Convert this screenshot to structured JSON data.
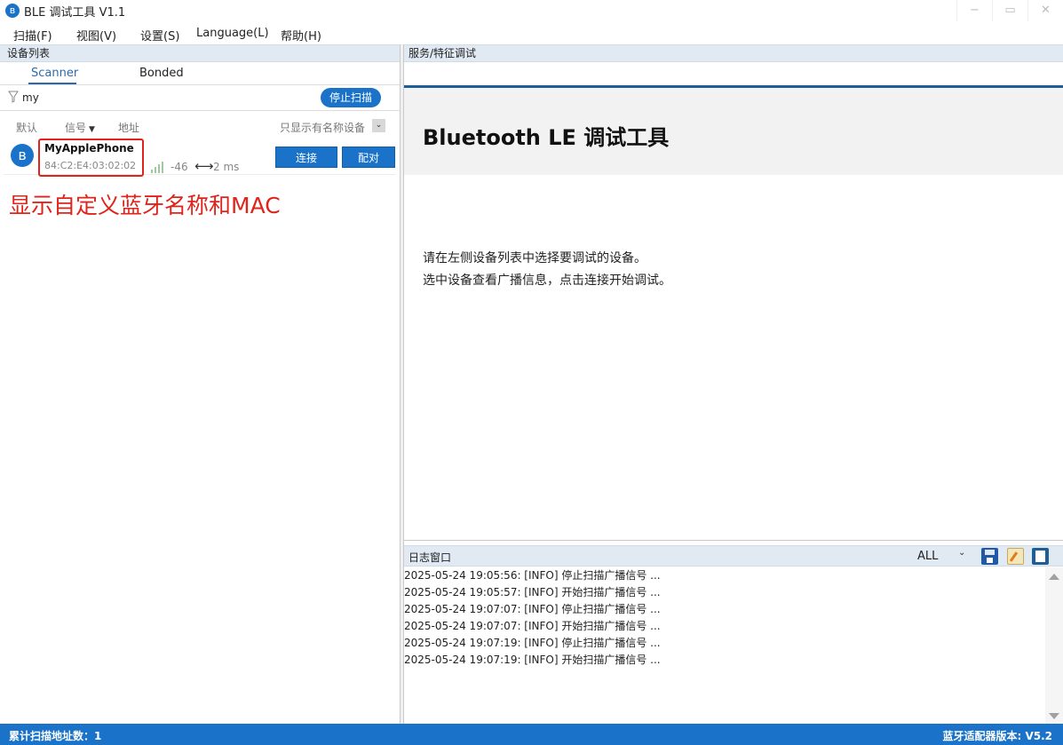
{
  "window": {
    "title": "BLE 调试工具 V1.1",
    "min_symbol": "−",
    "max_symbol": "▭",
    "close_symbol": "✕"
  },
  "menu": {
    "items": [
      "扫描(F)",
      "视图(V)",
      "设置(S)",
      "Language(L)",
      "帮助(H)"
    ]
  },
  "device_list": {
    "header": "设备列表",
    "tabs": [
      "Scanner",
      "Bonded"
    ],
    "active_tab": "Scanner",
    "filter_value": "my",
    "stop_scan_label": "停止扫描",
    "sort_options": [
      "默认",
      "信号",
      "地址"
    ],
    "named_only_label": "只显示有名称设备",
    "devices": [
      {
        "name": "MyApplePhone",
        "mac": "84:C2:E4:03:02:02",
        "rssi": "-46",
        "interval": "2 ms",
        "connect_label": "连接",
        "pair_label": "配对"
      }
    ],
    "annotation": "显示自定义蓝牙名称和MAC"
  },
  "service_panel": {
    "header": "服务/特征调试",
    "title": "Bluetooth LE 调试工具",
    "info_lines": [
      "请在左侧设备列表中选择要调试的设备。",
      "选中设备查看广播信息，点击连接开始调试。"
    ]
  },
  "log_panel": {
    "title": "日志窗口",
    "level": "ALL",
    "lines": [
      "2025-05-24 19:05:56:  [INFO] 停止扫描广播信号 ...",
      "2025-05-24 19:05:57:  [INFO] 开始扫描广播信号 ...",
      "2025-05-24 19:07:07:  [INFO] 停止扫描广播信号 ...",
      "2025-05-24 19:07:07:  [INFO] 开始扫描广播信号 ...",
      "2025-05-24 19:07:19:  [INFO] 停止扫描广播信号 ...",
      "2025-05-24 19:07:19:  [INFO] 开始扫描广播信号 ..."
    ]
  },
  "status_bar": {
    "left": "累计扫描地址数：1",
    "right": "蓝牙适配器版本: V5.2"
  },
  "colors": {
    "accent": "#1a73c8",
    "annotation": "#e0241b"
  }
}
